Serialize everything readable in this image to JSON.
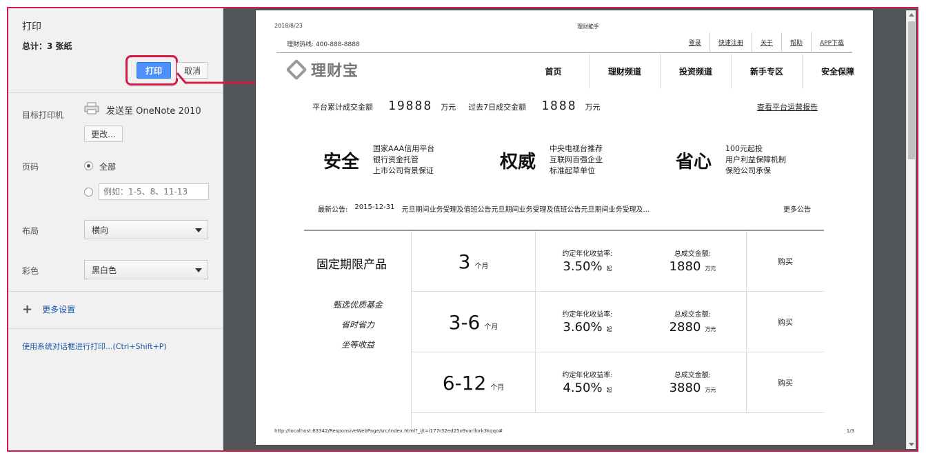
{
  "panel": {
    "title": "打印",
    "total": "总计：3 张纸",
    "print_label": "打印",
    "cancel_label": "取消",
    "printer_label": "目标打印机",
    "printer_name": "发送至 OneNote 2010",
    "change_label": "更改...",
    "pages_label": "页码",
    "pages_all": "全部",
    "pages_placeholder": "例如：1-5、8、11-13",
    "layout_label": "布局",
    "layout_value": "横向",
    "color_label": "彩色",
    "color_value": "黑白色",
    "more_settings": "更多设置",
    "system_dialog": "使用系统对话框进行打印...(Ctrl+Shift+P)"
  },
  "preview": {
    "date": "2018/8/23",
    "doc_title": "理财能手",
    "hotline": "理财热线: 400-888-8888",
    "top_links": [
      "登录",
      "快速注册",
      "关于",
      "帮助",
      "APP下载"
    ],
    "logo_text": "理财宝",
    "nav": [
      "首页",
      "理财频道",
      "投资频道",
      "新手专区",
      "安全保障"
    ],
    "stats": {
      "total_label": "平台累计成交金额",
      "total_value": "19888",
      "total_unit": "万元",
      "week_label": "过去7日成交金额",
      "week_value": "1888",
      "week_unit": "万元",
      "report_link": "查看平台运营报告"
    },
    "features": [
      {
        "title": "安全",
        "lines": [
          "国家AAA信用平台",
          "银行资金托管",
          "上市公司背景保证"
        ]
      },
      {
        "title": "权威",
        "lines": [
          "中央电视台推荐",
          "互联网百强企业",
          "标准起草单位"
        ]
      },
      {
        "title": "省心",
        "lines": [
          "100元起投",
          "用户利益保障机制",
          "保险公司承保"
        ]
      }
    ],
    "notice": {
      "label": "最新公告:",
      "date": "2015-12-31",
      "text": "元旦期间业务受理及值班公告元旦期间业务受理及值班公告元旦期间业务受理及...",
      "more": "更多公告"
    },
    "product_name": "固定期限产品",
    "slogans": [
      "甄选优质基金",
      "省时省力",
      "坐等收益"
    ],
    "rate_label": "约定年化收益率:",
    "amount_label": "总成交金额:",
    "start_suffix": "起",
    "amount_unit": "万元",
    "buy_label": "购买",
    "products": [
      {
        "term": "3",
        "unit": "个月",
        "rate": "3.50%",
        "amount": "1880"
      },
      {
        "term": "3-6",
        "unit": "个月",
        "rate": "3.60%",
        "amount": "2880"
      },
      {
        "term": "6-12",
        "unit": "个月",
        "rate": "4.50%",
        "amount": "3880"
      }
    ],
    "url": "http://localhost:63342/ResponsiveWebPage/src/index.html?_ijt=i177r32ed25o9varllork3kqqo#",
    "page_num": "1/3"
  },
  "colors": {
    "highlight": "#d51a4a",
    "print_button": "#4d90fe",
    "link": "#1a55a8"
  }
}
